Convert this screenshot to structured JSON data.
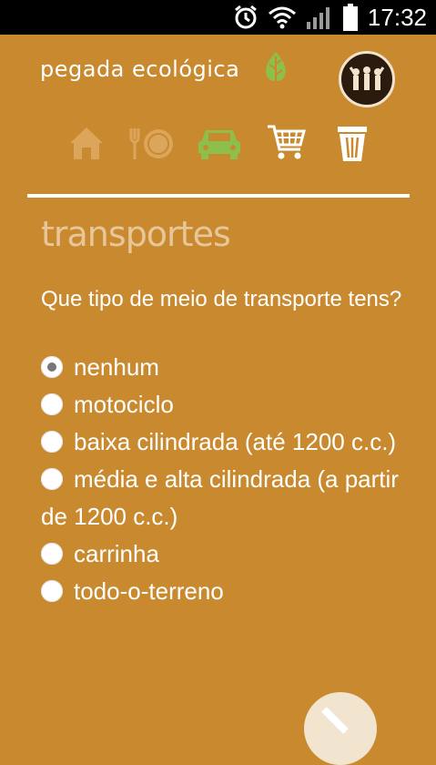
{
  "status_bar": {
    "time": "17:32",
    "icons": [
      "alarm-icon",
      "wifi-icon",
      "signal-icon",
      "battery-icon"
    ]
  },
  "app": {
    "brand": "pegada ecológica"
  },
  "nav": {
    "items": [
      {
        "name": "home",
        "icon": "house-icon",
        "state": "inactive"
      },
      {
        "name": "food",
        "icon": "plate-icon",
        "state": "inactive"
      },
      {
        "name": "transport",
        "icon": "car-icon",
        "state": "active"
      },
      {
        "name": "shopping",
        "icon": "cart-icon",
        "state": "normal"
      },
      {
        "name": "waste",
        "icon": "trash-icon",
        "state": "normal"
      }
    ]
  },
  "section": {
    "title": "transportes"
  },
  "question": {
    "text": "Que tipo de meio de transporte tens?",
    "options": [
      {
        "label": "nenhum",
        "selected": true
      },
      {
        "label": "motociclo",
        "selected": false
      },
      {
        "label": "baixa cilindrada (até 1200 c.c.)",
        "selected": false
      },
      {
        "label": "média e alta cilindrada (a partir de 1200 c.c.)",
        "selected": false
      },
      {
        "label": "carrinha",
        "selected": false
      },
      {
        "label": "todo-o-terreno",
        "selected": false
      }
    ]
  },
  "colors": {
    "background": "#c98a2f",
    "accent_green": "#8cc04b",
    "title_tint": "#e7c79a"
  }
}
